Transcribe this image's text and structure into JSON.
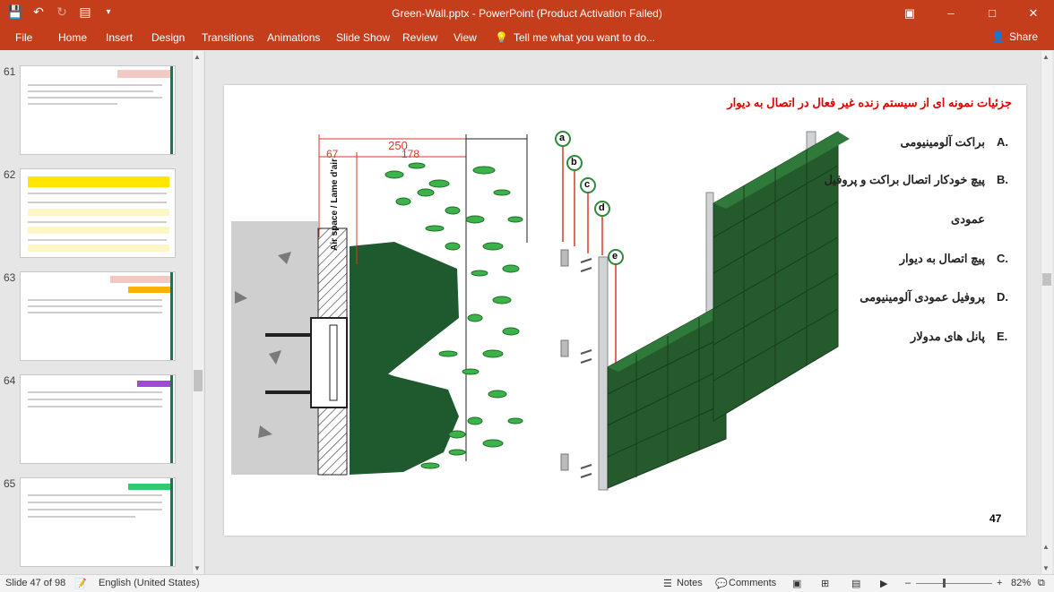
{
  "window": {
    "title": "Green-Wall.pptx - PowerPoint (Product Activation Failed)",
    "controls": [
      "restore-icon",
      "minimize-icon",
      "maximize-icon",
      "close-icon"
    ]
  },
  "qat": [
    "save-icon",
    "undo-icon",
    "redo-icon",
    "present-icon",
    "customize-icon"
  ],
  "ribbon": {
    "tabs": [
      "File",
      "Home",
      "Insert",
      "Design",
      "Transitions",
      "Animations",
      "Slide Show",
      "Review",
      "View"
    ],
    "tellme": "Tell me what you want to do...",
    "share": "Share"
  },
  "thumbnails": {
    "numbers": [
      "61",
      "62",
      "63",
      "64",
      "65"
    ]
  },
  "slide": {
    "title": "جزئیات نمونه ای از سیستم زنده غیر فعال در اتصال به دیوار",
    "items": [
      {
        "letter": "A.",
        "text": "براکت آلومینیومی"
      },
      {
        "letter": "B.",
        "text": "پیچ خودکار اتصال براکت و پروفیل"
      },
      {
        "letter": "",
        "text": "عمودی"
      },
      {
        "letter": "C.",
        "text": "پیچ اتصال به دیوار"
      },
      {
        "letter": "D.",
        "text": "پروفیل عمودی آلومینیومی"
      },
      {
        "letter": "E.",
        "text": "پانل های مدولار"
      }
    ],
    "dims": {
      "total": "250",
      "a": "67",
      "b": "178"
    },
    "air_label": "Air space / Lame d'air",
    "callouts": [
      "a",
      "b",
      "c",
      "d",
      "e"
    ],
    "page": "47"
  },
  "status": {
    "slide": "Slide 47 of 98",
    "language": "English (United States)",
    "notes": "Notes",
    "comments": "Comments",
    "zoom": "82%"
  }
}
